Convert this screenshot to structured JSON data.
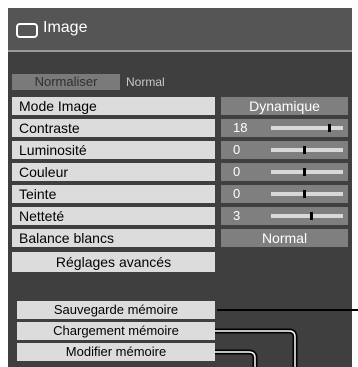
{
  "window": {
    "title": "Image",
    "icon": "monitor-icon"
  },
  "normalize": {
    "label": "Normaliser",
    "status": "Normal"
  },
  "settings": [
    {
      "id": "mode-image",
      "label": "Mode Image",
      "type": "select",
      "value": "Dynamique"
    },
    {
      "id": "contraste",
      "label": "Contraste",
      "type": "slider",
      "value": "18",
      "level": 0.82
    },
    {
      "id": "luminosite",
      "label": "Luminosité",
      "type": "slider",
      "value": "0",
      "level": 0.47
    },
    {
      "id": "couleur",
      "label": "Couleur",
      "type": "slider",
      "value": "0",
      "level": 0.47
    },
    {
      "id": "teinte",
      "label": "Teinte",
      "type": "slider",
      "value": "0",
      "level": 0.47
    },
    {
      "id": "nettete",
      "label": "Netteté",
      "type": "slider",
      "value": "3",
      "level": 0.56
    },
    {
      "id": "balance-blancs",
      "label": "Balance blancs",
      "type": "select",
      "value": "Normal"
    }
  ],
  "advanced": {
    "label": "Réglages avancés"
  },
  "memory": {
    "save_label": "Sauvegarde mémoire",
    "load_label": "Chargement mémoire",
    "edit_label": "Modifier mémoire"
  }
}
